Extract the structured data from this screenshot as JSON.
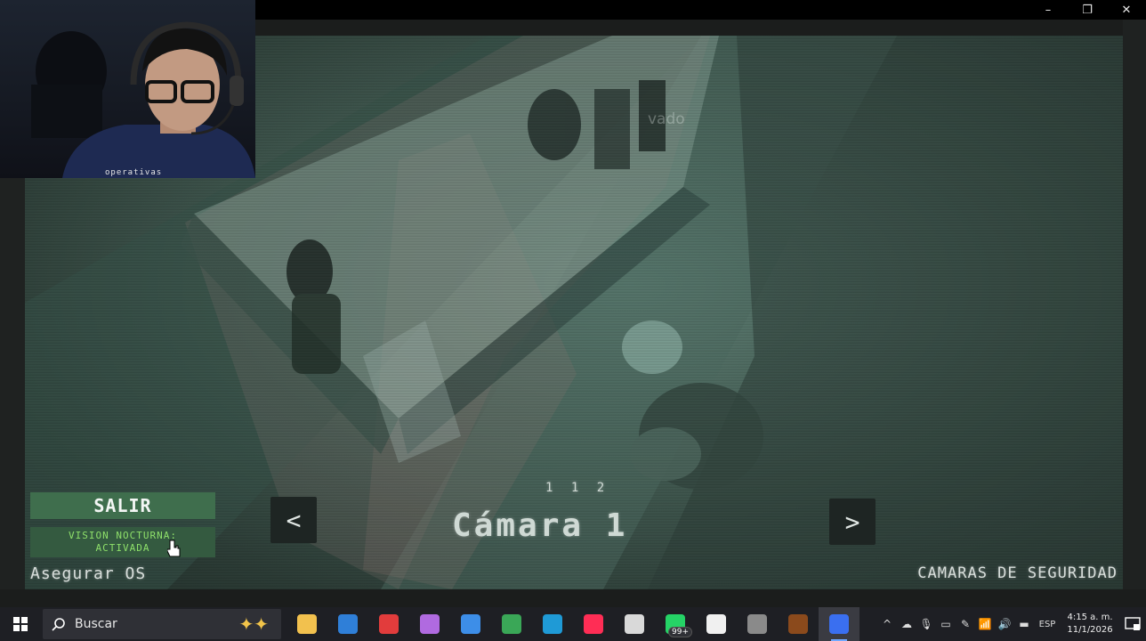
{
  "window": {
    "controls": [
      "–",
      "❐",
      "✕"
    ]
  },
  "webcam": {
    "caption": "operativas"
  },
  "camera": {
    "title": "Cámara 1",
    "index_label": "1 1 2",
    "ghost_text": "vado",
    "prev_label": "<",
    "next_label": ">",
    "colors": {
      "tint": "#5e7f74",
      "panel_green": "#3f6e4d",
      "vision_text": "#8ee06a"
    }
  },
  "hud": {
    "exit_label": "SALIR",
    "night_vision_line1": "VISION NOCTURNA:",
    "night_vision_line2": "ACTIVADA",
    "secure_os_label": "Asegurar OS",
    "section_label": "CAMARAS DE SEGURIDAD"
  },
  "taskbar": {
    "search_placeholder": "Buscar",
    "apps": [
      {
        "name": "file-explorer-icon",
        "color": "#f2c14e"
      },
      {
        "name": "outlook-icon",
        "color": "#2f7fd8"
      },
      {
        "name": "screen-recorder-icon",
        "color": "#e23c3c"
      },
      {
        "name": "copilot-icon",
        "color": "#b06ae0"
      },
      {
        "name": "store-icon",
        "color": "#3d8ee8"
      },
      {
        "name": "chrome-icon",
        "color": "#3aa757"
      },
      {
        "name": "edge-icon",
        "color": "#1f9ad6"
      },
      {
        "name": "tiktok-icon",
        "color": "#ff2d55"
      },
      {
        "name": "media-icon",
        "color": "#d9d9d9"
      },
      {
        "name": "whatsapp-icon",
        "color": "#25d366"
      },
      {
        "name": "notepad-icon",
        "color": "#f0f0f0"
      },
      {
        "name": "game-icon",
        "color": "#8a8a8a"
      },
      {
        "name": "fnaf-icon",
        "color": "#8b4a1c"
      },
      {
        "name": "roblox-icon",
        "color": "#3a6ff0"
      }
    ],
    "whatsapp_badge": "99+",
    "language": "ESP",
    "time": "4:15 a. m.",
    "date": "11/1/2026"
  }
}
